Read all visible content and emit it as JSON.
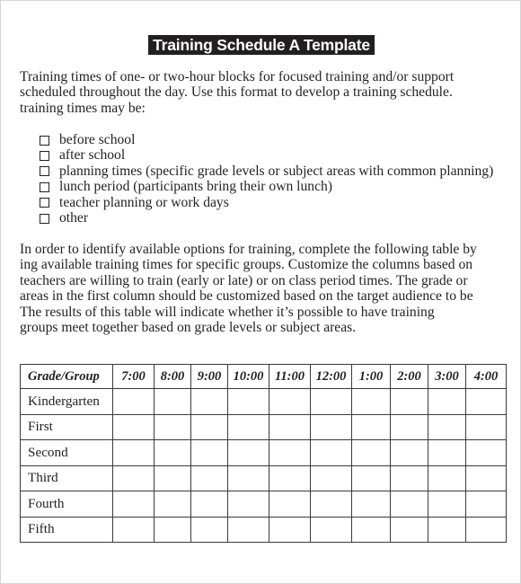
{
  "document": {
    "title": "Training Schedule A Template",
    "intro_lines": [
      "Training times of one- or two-hour blocks for focused training and/or support",
      "scheduled throughout the day. Use this format to develop a training schedule.",
      "training times may be:"
    ],
    "options": [
      "before school",
      "after school",
      "planning times (specific grade levels or subject areas with common planning)",
      "lunch period (participants bring their own lunch)",
      "teacher planning or work days",
      "other"
    ],
    "explain_lines": [
      "In order to identify available options for training, complete the following table by",
      "ing available training times for specific groups. Customize the columns based on",
      "teachers are willing to train (early or late) or on class period times. The grade or",
      "areas in the first column should be customized based on the target audience to be",
      "The results of this table will indicate whether it’s possible to have training",
      "groups meet together based on grade levels or subject areas."
    ]
  },
  "table": {
    "header_first": "Grade/Group",
    "times": [
      "7:00",
      "8:00",
      "9:00",
      "10:00",
      "11:00",
      "12:00",
      "1:00",
      "2:00",
      "3:00",
      "4:00"
    ],
    "rows": [
      "Kindergarten",
      "First",
      "Second",
      "Third",
      "Fourth",
      "Fifth"
    ]
  }
}
